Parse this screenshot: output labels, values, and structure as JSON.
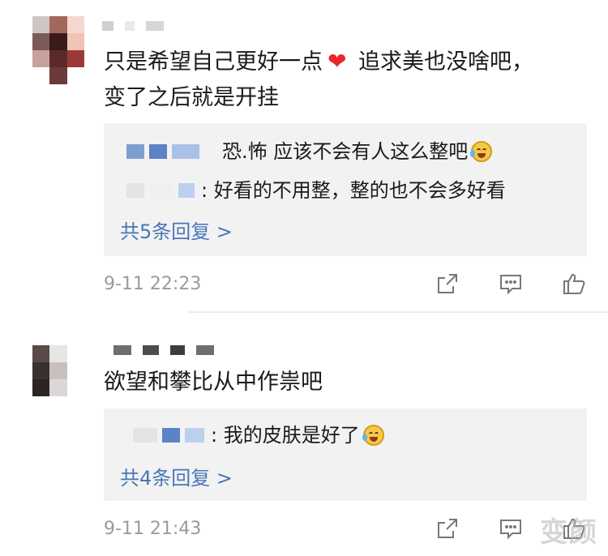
{
  "comments": [
    {
      "text_part1": "只是希望自己更好一点",
      "text_part2": " 追求美也没啥吧，",
      "text_line2": "变了之后就是开挂",
      "replies": [
        "恐.怖 应该不会有人这么整吧",
        ": 好看的不用整，整的也不会多好看"
      ],
      "more_replies": "共5条回复 >",
      "time": "9-11 22:23"
    },
    {
      "text_part1": "欲望和攀比从中作祟吧",
      "replies": [
        ": 我的皮肤是好了"
      ],
      "more_replies": "共4条回复 >",
      "time": "9-11 21:43"
    }
  ],
  "watermark": "变颜",
  "icons": {
    "share": "share-icon",
    "reply": "comment-icon",
    "like": "thumbs-up-icon",
    "heart": "heart-emoji",
    "laugh": "laugh-cry-emoji"
  },
  "colors": {
    "link": "#4a76b8",
    "reply_bg": "#f2f2f2",
    "time": "#9a9a9a",
    "heart": "#e8262b"
  }
}
